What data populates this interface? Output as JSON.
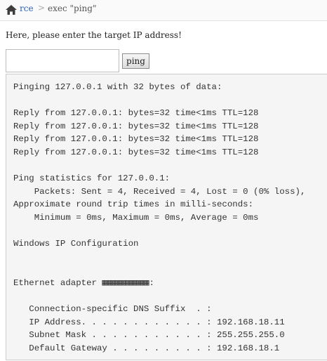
{
  "breadcrumb": {
    "home_icon": "home-icon",
    "link_label": "rce",
    "separator": ">",
    "current_label": "exec \"ping\""
  },
  "form": {
    "prompt": "Here, please enter the target IP address!",
    "input_value": "",
    "input_placeholder": "",
    "button_label": "ping"
  },
  "output": {
    "text": "Pinging 127.0.0.1 with 32 bytes of data:\n\nReply from 127.0.0.1: bytes=32 time<1ms TTL=128\nReply from 127.0.0.1: bytes=32 time<1ms TTL=128\nReply from 127.0.0.1: bytes=32 time<1ms TTL=128\nReply from 127.0.0.1: bytes=32 time<1ms TTL=128\n\nPing statistics for 127.0.0.1:\n    Packets: Sent = 4, Received = 4, Lost = 0 (0% loss),\nApproximate round trip times in milli-seconds:\n    Minimum = 0ms, Maximum = 0ms, Average = 0ms\n\nWindows IP Configuration\n\n\nEthernet adapter ▦▦▦▦▦▦▦▦▦:\n\n   Connection-specific DNS Suffix  . :\n   IP Address. . . . . . . . . . . . : 192.168.18.11\n   Subnet Mask . . . . . . . . . . . : 255.255.255.0\n   Default Gateway . . . . . . . . . : 192.168.18.1"
  },
  "colors": {
    "link": "#2a62b8",
    "output_background": "#f5f5f5",
    "button_gradient_top": "#f6f6f6"
  }
}
